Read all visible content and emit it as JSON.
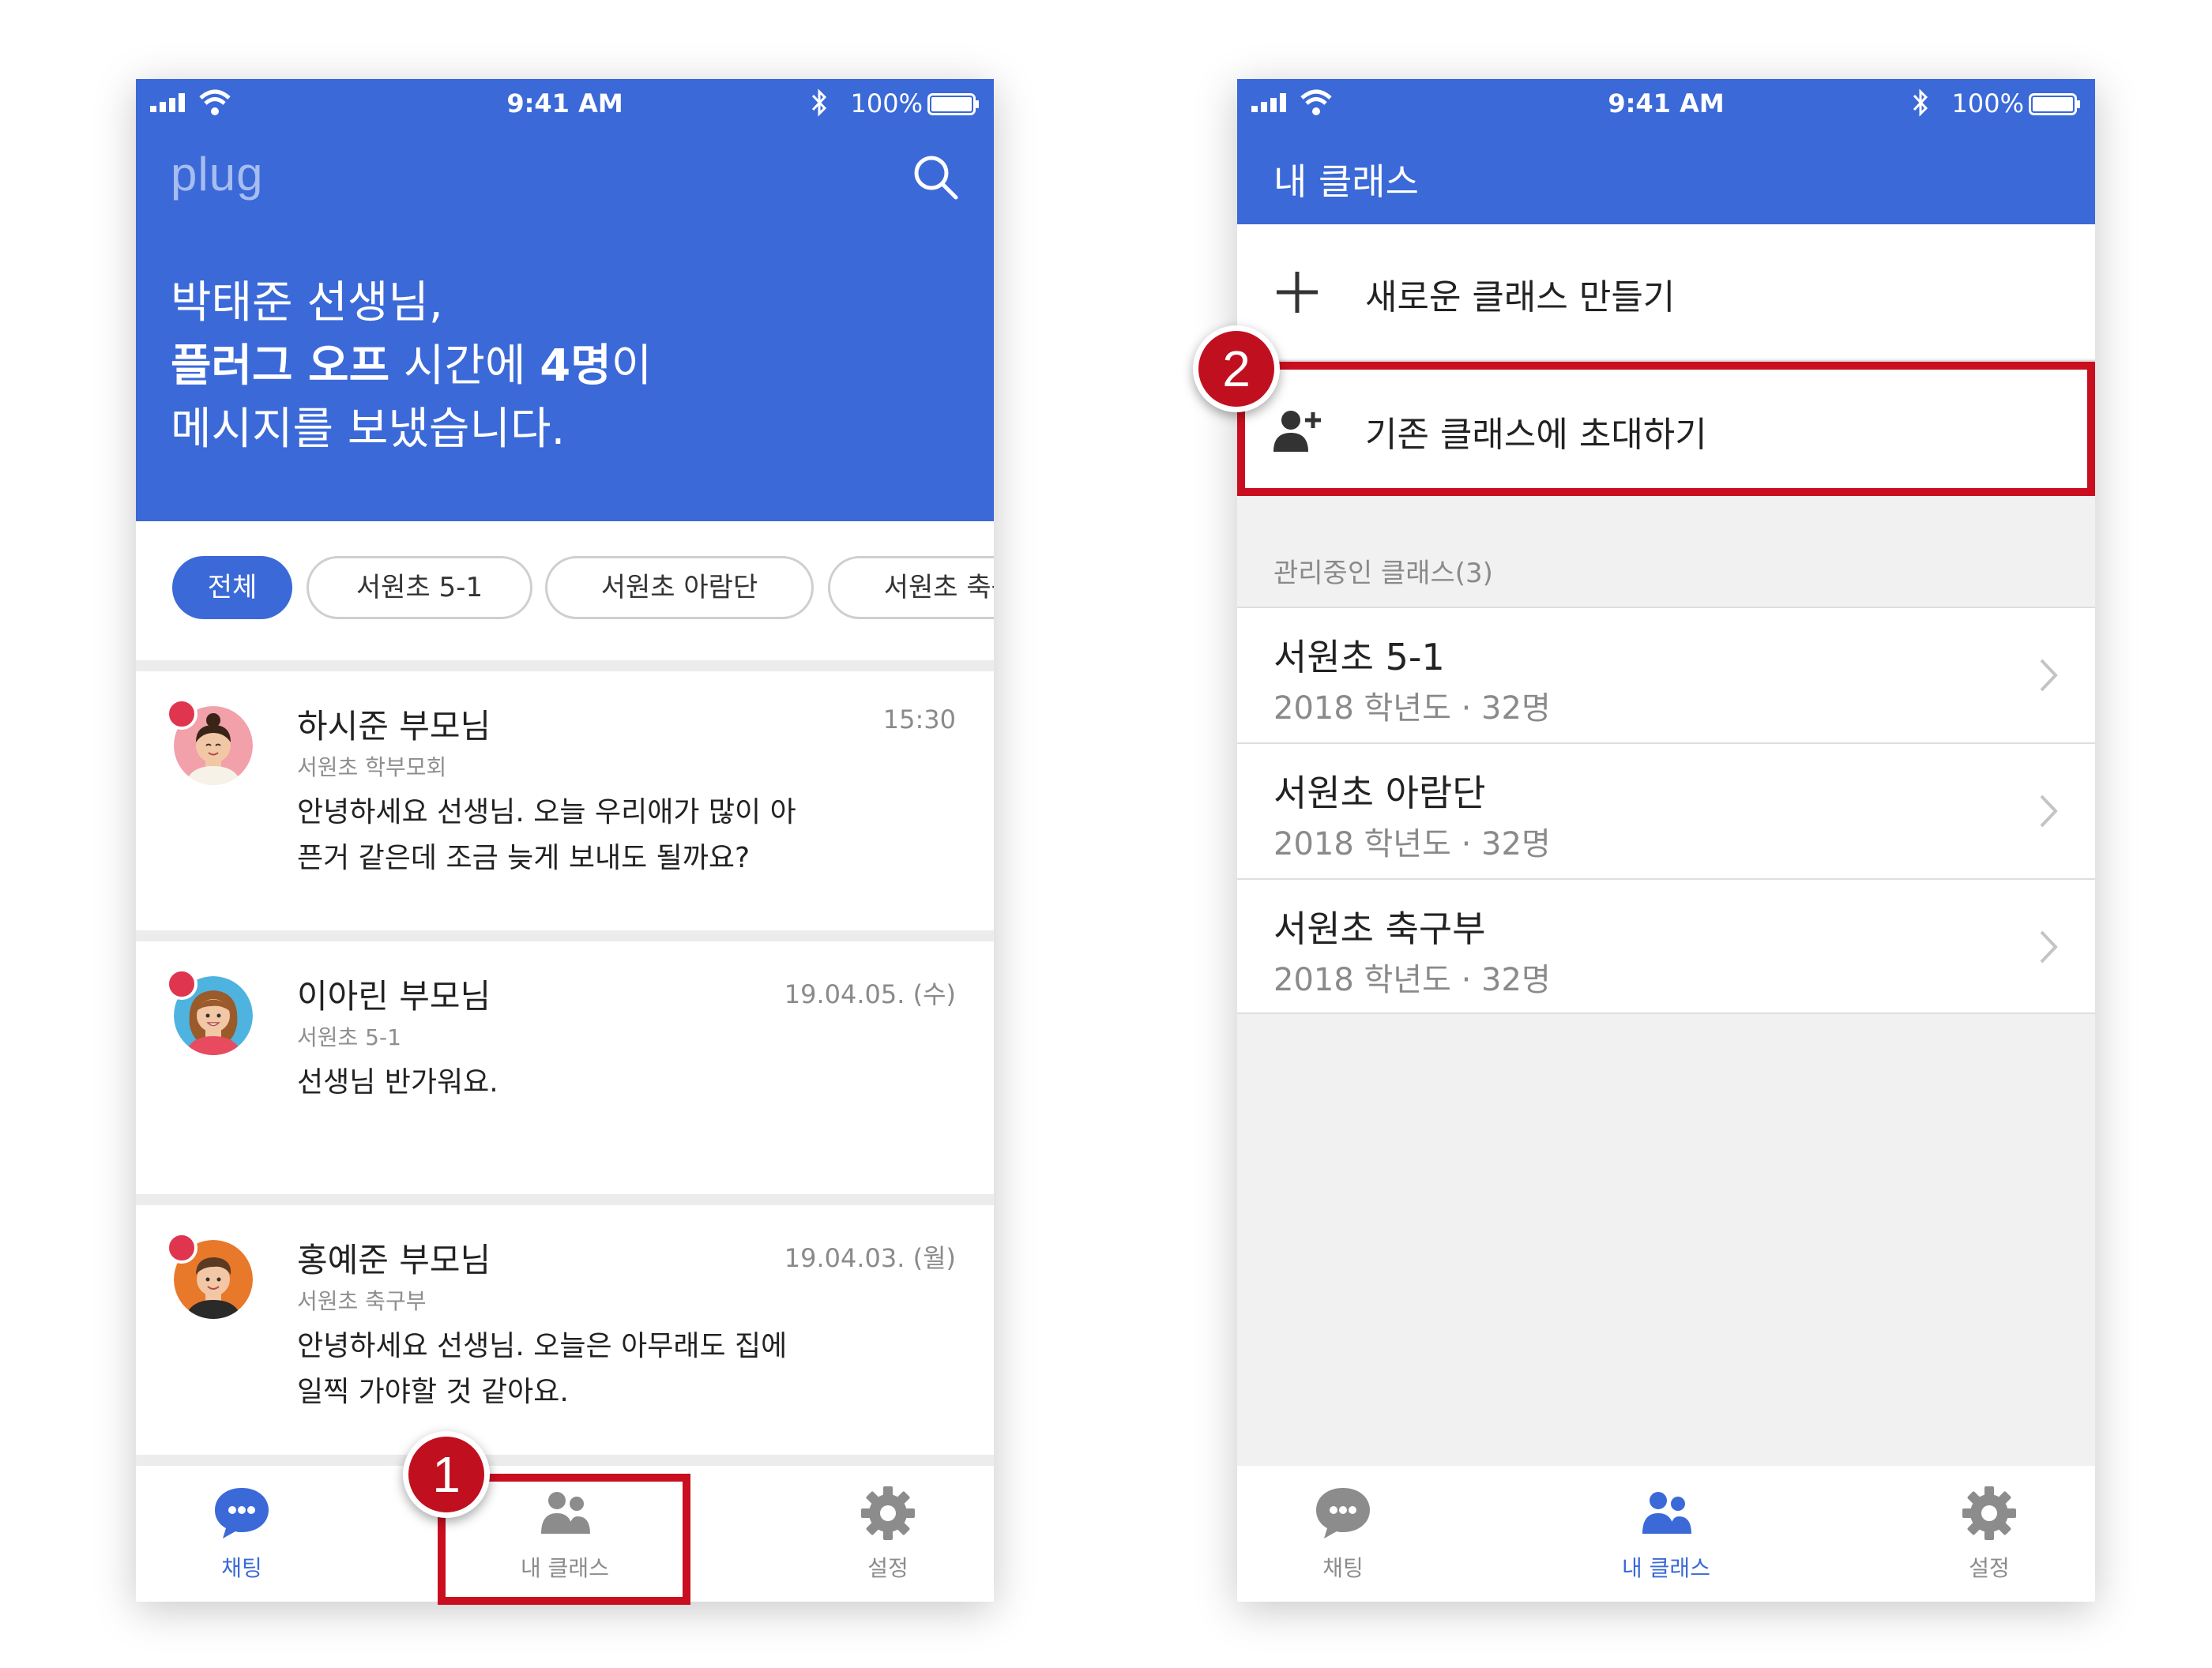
{
  "status_bar": {
    "time": "9:41 AM",
    "battery": "100%"
  },
  "screen1": {
    "logo": "plug",
    "greeting": {
      "line1": "박태준 선생님,",
      "line2_bold1": "플러그 오프",
      "line2_mid": " 시간에 ",
      "line2_bold2": "4명",
      "line2_end": "이",
      "line3": "메시지를 보냈습니다."
    },
    "chips": [
      "전체",
      "서원초 5-1",
      "서원초 아람단",
      "서원초 축구부"
    ],
    "messages": [
      {
        "name": "하시준 부모님",
        "time": "15:30",
        "group": "서원초 학부모회",
        "line1": "안녕하세요 선생님. 오늘 우리애가 많이 아",
        "line2": "픈거 같은데 조금 늦게 보내도 될까요?"
      },
      {
        "name": "이아린 부모님",
        "time": "19.04.05. (수)",
        "group": "서원초 5-1",
        "line1": "선생님 반가워요.",
        "line2": ""
      },
      {
        "name": "홍예준 부모님",
        "time": "19.04.03. (월)",
        "group": "서원초 축구부",
        "line1": "안녕하세요 선생님. 오늘은 아무래도 집에",
        "line2": "일찍 가야할 것 같아요."
      }
    ],
    "tabs": {
      "chat": "채팅",
      "classes": "내 클래스",
      "settings": "설정"
    },
    "callout": "1"
  },
  "screen2": {
    "title": "내 클래스",
    "actions": {
      "new_class": "새로운 클래스 만들기",
      "invite": "기존 클래스에 초대하기"
    },
    "section_header": "관리중인 클래스(3)",
    "classes": [
      {
        "name": "서원초 5-1",
        "meta": "2018 학년도 · 32명"
      },
      {
        "name": "서원초 아람단",
        "meta": "2018 학년도 · 32명"
      },
      {
        "name": "서원초 축구부",
        "meta": "2018 학년도 · 32명"
      }
    ],
    "tabs": {
      "chat": "채팅",
      "classes": "내 클래스",
      "settings": "설정"
    },
    "callout": "2"
  },
  "colors": {
    "brand_blue": "#3b69d8",
    "callout_red": "#c90f1f",
    "unread_dot": "#e0354f"
  }
}
